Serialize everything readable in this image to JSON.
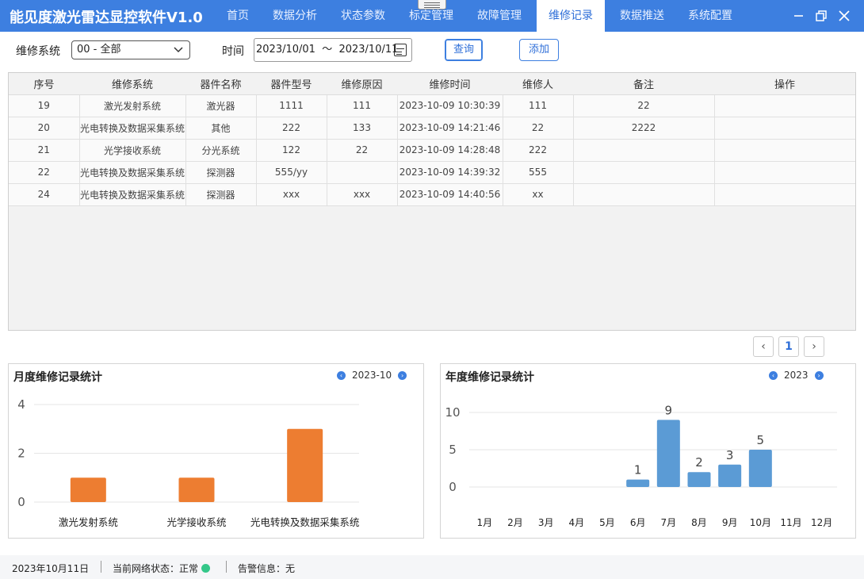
{
  "app": {
    "title": "能见度激光雷达显控软件V1.0",
    "nav": [
      "首页",
      "数据分析",
      "状态参数",
      "标定管理",
      "故障管理",
      "维修记录",
      "数据推送",
      "系统配置"
    ],
    "active_nav": "维修记录",
    "window_controls": [
      "minimize-icon",
      "restore-icon",
      "close-icon"
    ]
  },
  "filter": {
    "system_label": "维修系统",
    "system_value": "00 - 全部",
    "time_label": "时间",
    "date_range": "2023/10/01  ～  2023/10/11",
    "query_label": "查询",
    "add_label": "添加"
  },
  "table": {
    "headers": [
      "序号",
      "维修系统",
      "器件名称",
      "器件型号",
      "维修原因",
      "维修时间",
      "维修人",
      "备注",
      "操作"
    ],
    "rows": [
      [
        "19",
        "激光发射系统",
        "激光器",
        "1111",
        "111",
        "2023-10-09 10:30:39",
        "111",
        "22",
        ""
      ],
      [
        "20",
        "光电转换及数据采集系统",
        "其他",
        "222",
        "133",
        "2023-10-09 14:21:46",
        "22",
        "2222",
        ""
      ],
      [
        "21",
        "光学接收系统",
        "分光系统",
        "122",
        "22",
        "2023-10-09 14:28:48",
        "222",
        "",
        ""
      ],
      [
        "22",
        "光电转换及数据采集系统",
        "探测器",
        "555/yy",
        "",
        "2023-10-09 14:39:32",
        "555",
        "",
        ""
      ],
      [
        "24",
        "光电转换及数据采集系统",
        "探测器",
        "xxx",
        "xxx",
        "2023-10-09 14:40:56",
        "xx",
        "",
        ""
      ]
    ]
  },
  "pagination": {
    "prev": "‹",
    "current": "1",
    "next": "›"
  },
  "monthly": {
    "title": "月度维修记录统计",
    "period": "2023-10"
  },
  "yearly": {
    "title": "年度维修记录统计",
    "period": "2023"
  },
  "chart_data": [
    {
      "type": "bar",
      "title": "月度维修记录统计",
      "categories": [
        "激光发射系统",
        "光学接收系统",
        "光电转换及数据采集系统"
      ],
      "values": [
        1,
        1,
        3
      ],
      "ylim": [
        0,
        4
      ],
      "yticks": [
        0,
        2,
        4
      ],
      "color": "#ed7d31",
      "grid": true
    },
    {
      "type": "bar",
      "title": "年度维修记录统计",
      "categories": [
        "1月",
        "2月",
        "3月",
        "4月",
        "5月",
        "6月",
        "7月",
        "8月",
        "9月",
        "10月",
        "11月",
        "12月"
      ],
      "values": [
        null,
        null,
        null,
        null,
        null,
        1,
        9,
        2,
        3,
        5,
        null,
        null
      ],
      "data_labels": true,
      "ylim": [
        0,
        10
      ],
      "yticks": [
        0,
        5,
        10
      ],
      "color": "#5b9bd5",
      "grid": true
    }
  ],
  "status": {
    "date": "2023年10月11日",
    "network_label": "当前网络状态：正常",
    "network_color": "#34c789",
    "alarm_label": "告警信息：无"
  }
}
